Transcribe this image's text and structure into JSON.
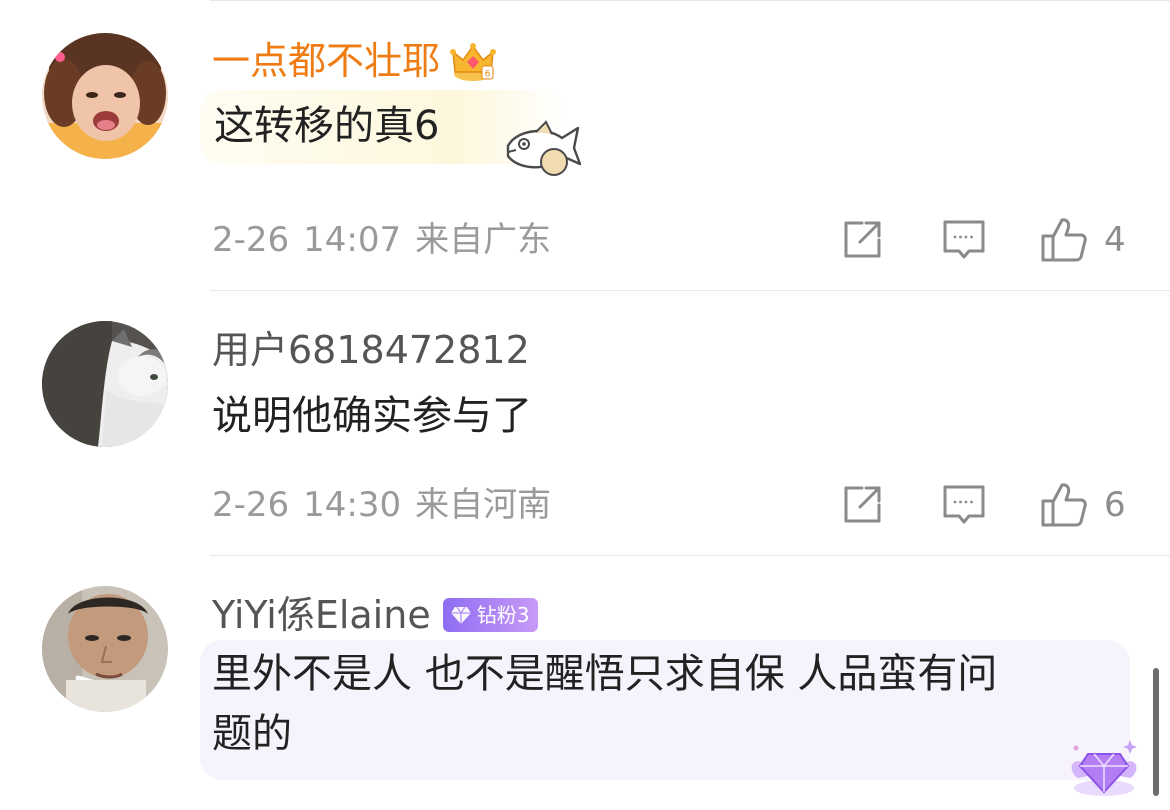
{
  "comments": [
    {
      "username": "一点都不壮耶",
      "content": "这转移的真6",
      "date": "2-26",
      "time": "14:07",
      "location": "来自广东",
      "likes": "4",
      "badge_icon": "vip-crown-icon"
    },
    {
      "username": "用户6818472812",
      "content": "说明他确实参与了",
      "date": "2-26",
      "time": "14:30",
      "location": "来自河南",
      "likes": "6"
    },
    {
      "username": "YiYi係Elaine",
      "fan_badge": "钻粉3",
      "content_line1": "里外不是人 也不是醒悟只求自保 人品蛮有问",
      "content_line2": "题的"
    }
  ],
  "icons": [
    "vip-crown-icon",
    "fish-sticker-icon",
    "share-icon",
    "comment-icon",
    "like-icon",
    "diamond-gem-icon"
  ],
  "colors": {
    "vip_name": "#ef7c12",
    "meta_text": "#9a9a9a",
    "fan_badge": "#9b77f3",
    "divider": "#e9e9e9"
  }
}
